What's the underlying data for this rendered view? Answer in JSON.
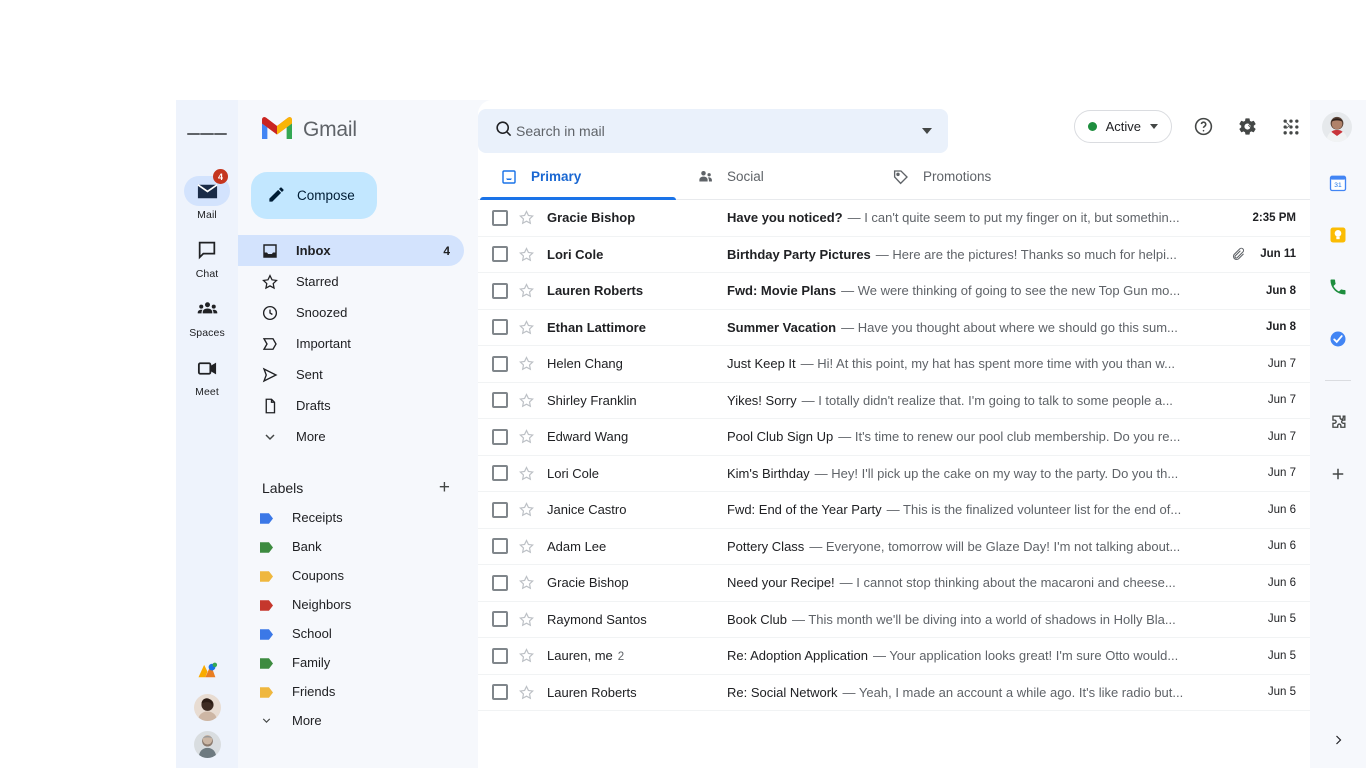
{
  "brand": {
    "name": "Gmail",
    "logo_icon": "gmail-m-logo",
    "menu_icon": "hamburger-menu-icon"
  },
  "search": {
    "placeholder": "Search in mail",
    "value": "",
    "icon": "search-icon",
    "options_icon": "show-search-options-chevron"
  },
  "header": {
    "status_label": "Active",
    "status_color": "#1e8e3e",
    "status_caret_icon": "chevron-down-icon",
    "support_icon": "help-question-icon",
    "settings_icon": "gear-icon",
    "apps_icon": "google-apps-grid-icon",
    "avatar_icon": "account-avatar"
  },
  "rail": {
    "items": [
      {
        "label": "Mail",
        "icon": "mail-envelope-icon",
        "badge": "4",
        "active": true
      },
      {
        "label": "Chat",
        "icon": "chat-bubble-icon",
        "badge": "",
        "active": false
      },
      {
        "label": "Spaces",
        "icon": "spaces-people-icon",
        "badge": "",
        "active": false
      },
      {
        "label": "Meet",
        "icon": "meet-camera-icon",
        "badge": "",
        "active": false
      }
    ],
    "bottom": [
      {
        "icon": "spaces-colored-logo"
      },
      {
        "icon": "contact-avatar-1"
      },
      {
        "icon": "contact-avatar-2"
      }
    ]
  },
  "compose": {
    "label": "Compose",
    "icon": "pencil-compose-icon"
  },
  "folders": [
    {
      "label": "Inbox",
      "icon": "inbox-icon",
      "count": "4",
      "active": true
    },
    {
      "label": "Starred",
      "icon": "star-outline-icon",
      "count": "",
      "active": false
    },
    {
      "label": "Snoozed",
      "icon": "clock-icon",
      "count": "",
      "active": false
    },
    {
      "label": "Important",
      "icon": "important-label-icon",
      "count": "",
      "active": false
    },
    {
      "label": "Sent",
      "icon": "send-paper-plane-icon",
      "count": "",
      "active": false
    },
    {
      "label": "Drafts",
      "icon": "draft-page-icon",
      "count": "",
      "active": false
    },
    {
      "label": "More",
      "icon": "chevron-down-icon",
      "count": "",
      "active": false
    }
  ],
  "labels_section": {
    "title": "Labels",
    "add_icon": "plus-icon",
    "more_label": "More",
    "more_icon": "chevron-down-icon",
    "items": [
      {
        "label": "Receipts",
        "color": "#3b78e7"
      },
      {
        "label": "Bank",
        "color": "#3d8b40"
      },
      {
        "label": "Coupons",
        "color": "#efb73e"
      },
      {
        "label": "Neighbors",
        "color": "#c5372c"
      },
      {
        "label": "School",
        "color": "#3b78e7"
      },
      {
        "label": "Family",
        "color": "#3d8b40"
      },
      {
        "label": "Friends",
        "color": "#efb73e"
      }
    ]
  },
  "toolbar": {
    "select_all_icon": "checkbox-icon",
    "select_caret_icon": "chevron-down-icon",
    "refresh_icon": "refresh-icon",
    "prev_icon": "chevron-left-icon",
    "next_icon": "chevron-right-icon"
  },
  "tabs": [
    {
      "label": "Primary",
      "icon": "inbox-tab-icon",
      "active": true
    },
    {
      "label": "Social",
      "icon": "social-people-icon",
      "active": false
    },
    {
      "label": "Promotions",
      "icon": "promotions-tag-icon",
      "active": false
    }
  ],
  "emails": [
    {
      "sender": "Gracie Bishop",
      "thread_count": "",
      "subject": "Have you noticed?",
      "snippet": "— I can't quite seem to put my finger on it, but somethin...",
      "date": "2:35 PM",
      "unread": true,
      "attachment": false,
      "starred": false
    },
    {
      "sender": "Lori Cole",
      "thread_count": "",
      "subject": "Birthday Party Pictures",
      "snippet": "— Here are the pictures! Thanks so much for helpi...",
      "date": "Jun 11",
      "unread": true,
      "attachment": true,
      "starred": false
    },
    {
      "sender": "Lauren Roberts",
      "thread_count": "",
      "subject": "Fwd: Movie Plans",
      "snippet": "— We were thinking of going to see the new Top Gun mo...",
      "date": "Jun 8",
      "unread": true,
      "attachment": false,
      "starred": false
    },
    {
      "sender": "Ethan Lattimore",
      "thread_count": "",
      "subject": "Summer Vacation",
      "snippet": "— Have you thought about where we should go this sum...",
      "date": "Jun 8",
      "unread": true,
      "attachment": false,
      "starred": false
    },
    {
      "sender": "Helen Chang",
      "thread_count": "",
      "subject": "Just Keep It",
      "snippet": "— Hi! At this point, my hat has spent more time with you than w...",
      "date": "Jun 7",
      "unread": false,
      "attachment": false,
      "starred": false
    },
    {
      "sender": "Shirley Franklin",
      "thread_count": "",
      "subject": "Yikes! Sorry",
      "snippet": "— I totally didn't realize that. I'm going to talk to some people a...",
      "date": "Jun 7",
      "unread": false,
      "attachment": false,
      "starred": false
    },
    {
      "sender": "Edward Wang",
      "thread_count": "",
      "subject": "Pool Club Sign Up",
      "snippet": "— It's time to renew our pool club membership. Do you re...",
      "date": "Jun 7",
      "unread": false,
      "attachment": false,
      "starred": false
    },
    {
      "sender": "Lori Cole",
      "thread_count": "",
      "subject": "Kim's Birthday",
      "snippet": "— Hey! I'll pick up the cake on my way to the party. Do you th...",
      "date": "Jun 7",
      "unread": false,
      "attachment": false,
      "starred": false
    },
    {
      "sender": "Janice Castro",
      "thread_count": "",
      "subject": "Fwd: End of the Year Party",
      "snippet": "— This is the finalized volunteer list for the end of...",
      "date": "Jun 6",
      "unread": false,
      "attachment": false,
      "starred": false
    },
    {
      "sender": "Adam Lee",
      "thread_count": "",
      "subject": "Pottery Class",
      "snippet": "— Everyone, tomorrow will be Glaze Day! I'm not talking about...",
      "date": "Jun 6",
      "unread": false,
      "attachment": false,
      "starred": false
    },
    {
      "sender": "Gracie Bishop",
      "thread_count": "",
      "subject": "Need your Recipe!",
      "snippet": "— I cannot stop thinking about the macaroni and cheese...",
      "date": "Jun 6",
      "unread": false,
      "attachment": false,
      "starred": false
    },
    {
      "sender": "Raymond Santos",
      "thread_count": "",
      "subject": "Book Club",
      "snippet": "— This month we'll be diving into a world of shadows in Holly Bla...",
      "date": "Jun 5",
      "unread": false,
      "attachment": false,
      "starred": false
    },
    {
      "sender": "Lauren, me",
      "thread_count": "2",
      "subject": "Re: Adoption Application",
      "snippet": "— Your application looks great! I'm sure Otto would...",
      "date": "Jun 5",
      "unread": false,
      "attachment": false,
      "starred": false
    },
    {
      "sender": "Lauren Roberts",
      "thread_count": "",
      "subject": "Re: Social Network",
      "snippet": "— Yeah, I made an account a while ago. It's like radio but...",
      "date": "Jun 5",
      "unread": false,
      "attachment": false,
      "starred": false
    }
  ],
  "right_rail": {
    "items": [
      {
        "icon": "google-calendar-icon"
      },
      {
        "icon": "google-keep-icon"
      },
      {
        "icon": "google-contacts-phone-icon"
      },
      {
        "icon": "google-tasks-icon"
      },
      {
        "icon": "addons-puzzle-icon"
      },
      {
        "icon": "plus-icon"
      }
    ],
    "expand_icon": "chevron-right-icon"
  }
}
